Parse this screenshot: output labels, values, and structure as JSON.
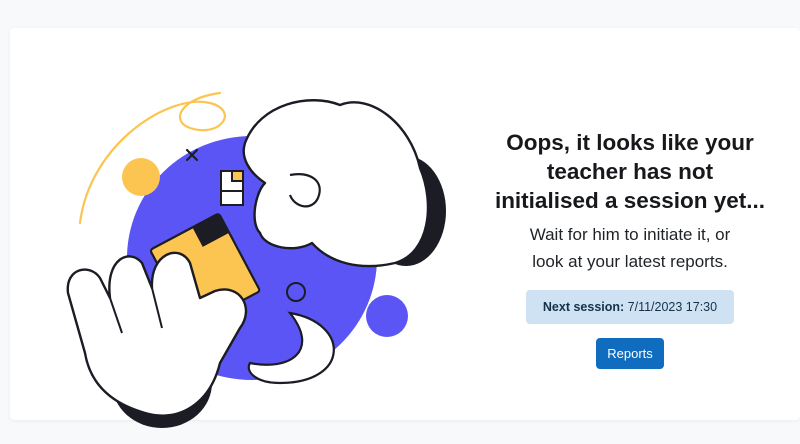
{
  "empty_state": {
    "heading_line1": "Oops, it looks like your",
    "heading_line2": "teacher has not",
    "heading_line3": "initialised a session yet...",
    "subtext_line1": "Wait for him to initiate it, or",
    "subtext_line2": "look at your latest reports.",
    "next_session": {
      "label": "Next session:",
      "value": "7/11/2023 17:30"
    },
    "reports_button": "Reports"
  },
  "colors": {
    "accent_blue": "#5a55f4",
    "accent_yellow": "#fcc451",
    "button_blue": "#0f6cbf",
    "badge_bg": "#cfe2f3"
  }
}
